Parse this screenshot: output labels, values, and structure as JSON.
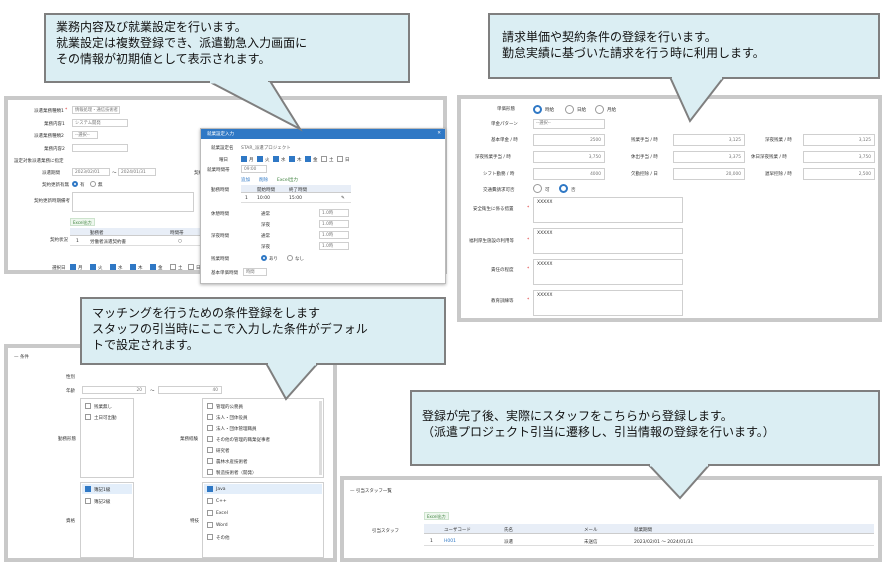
{
  "callouts": {
    "c1": [
      "業務内容及び就業設定を行います。",
      "就業設定は複数登録でき、派遣勤急入力画面に",
      "その情報が初期値として表示されます。"
    ],
    "c2": [
      "請求単価や契約条件の登録を行います。",
      "勤怠実績に基づいた請求を行う時に利用します。"
    ],
    "c3": [
      "マッチングを行うための条件登録をします",
      "スタッフの引当時にここで入力した条件がデフォル",
      "トで設定されます。"
    ],
    "c4": [
      "登録が完了後、実際にスタッフをこちらから登録します。",
      "（派遣プロジェクト引当に遷移し、引当情報の登録を行います。）"
    ]
  },
  "panel1": {
    "labels": [
      "派遣業務種類1",
      "業務内容1",
      "派遣業務種類2",
      "業務内容2",
      "設定対象派遣業務に指定",
      "派遣期間",
      "契約更新有無",
      "契約更新時期備考",
      "契約状況",
      "選択日"
    ],
    "values": {
      "kind1": "情報処理・通信技術者",
      "content1": "システム開発",
      "kind2": "--選択--",
      "period_from": "2023/02/01",
      "period_to": "2024/01/31",
      "tilde": "〜"
    },
    "radio": [
      "有",
      "無"
    ],
    "excel": "Excel出力",
    "grid_headers": [
      "",
      "勤務者",
      "時間帯",
      "職務"
    ],
    "grid_row": [
      "1",
      "労働者派遣契約書"
    ],
    "weekdays": [
      "月",
      "火",
      "水",
      "木",
      "金",
      "土",
      "日"
    ],
    "side_label": "契約人数"
  },
  "modal": {
    "title": "就業設定入力",
    "labels": [
      "就業設定名",
      "曜日",
      "就業時間帯",
      "勤務時間",
      "休憩時間",
      "深夜時間",
      "残業時間",
      "基本単価時間"
    ],
    "name_val": "STAR_派遣プロジェクト",
    "days": [
      "月",
      "火",
      "水",
      "木",
      "金",
      "土",
      "日"
    ],
    "toolbar": [
      "追加",
      "削除",
      "Excel出力"
    ],
    "grid_headers": [
      "",
      "開始時間",
      "終了時間"
    ],
    "grid_row": [
      "1",
      "10:00",
      "15:00"
    ],
    "time_labels": [
      "通常",
      "深夜",
      "通常",
      "深夜"
    ],
    "time_vals": [
      "1.0時",
      "1.0時",
      "1.0時",
      "1.0時"
    ],
    "sample_labels": [
      "あり",
      "なし"
    ],
    "select_val": "時間"
  },
  "panel2": {
    "billing_label": "単価形態",
    "billing_opts": [
      "時給",
      "日給",
      "月給"
    ],
    "pattern_label": "単金パターン",
    "pattern_val": "--選択--",
    "rows": [
      [
        [
          "基本単金 / 時",
          "2500"
        ],
        [
          "残業手当 / 時",
          "3,125"
        ],
        [
          "深夜残業 / 時",
          "3,125"
        ]
      ],
      [
        [
          "深夜残業手当 / 時",
          "3,750"
        ],
        [
          "休出手当 / 時",
          "3,375"
        ],
        [
          "休日深夜残業 / 時",
          "3,750"
        ]
      ],
      [
        [
          "シフト勤務 / 時",
          "4000"
        ],
        [
          "欠勤控除 / 日",
          "20,000"
        ],
        [
          "遅早控除 / 時",
          "2,500"
        ]
      ]
    ],
    "transport_label": "交通費請求可否",
    "transport_opts": [
      "可",
      "否"
    ],
    "text_labels": [
      "安全衛生に係る措置",
      "福利厚生施設の利用等",
      "責任の程度",
      "教育訓練等"
    ],
    "text_vals": [
      "XXXXX",
      "XXXXX",
      "XXXXX",
      "XXXXX"
    ]
  },
  "panel3": {
    "section": "条件",
    "labels": [
      "性別",
      "年齢",
      "勤務形態",
      "業務経験",
      "資格",
      "特技"
    ],
    "age_vals": [
      "20",
      "40"
    ],
    "work_items": [
      "残業無し",
      "土日可出勤"
    ],
    "exp_items": [
      "管理的公務員",
      "法人・団体役員",
      "法人・団体管理職員",
      "その他の管理的職業従事者",
      "研究者",
      "農林水産技術者",
      "製造技術者（開発）"
    ],
    "qual_items": [
      "簿記1級",
      "簿記2級"
    ],
    "skill_items": [
      "Java",
      "C++",
      "Excel",
      "Word",
      "その他"
    ]
  },
  "panel4": {
    "section": "引当スタッフ一覧",
    "excel": "Excel出力",
    "left_label": "引当スタッフ",
    "headers": [
      "ユーザコード",
      "氏名",
      "メール",
      "就業期間"
    ],
    "row": {
      "no": "1",
      "code": "H001",
      "name": "派遣",
      "mail": "未送信",
      "period": "2023/02/01 〜 2024/01/31"
    }
  }
}
